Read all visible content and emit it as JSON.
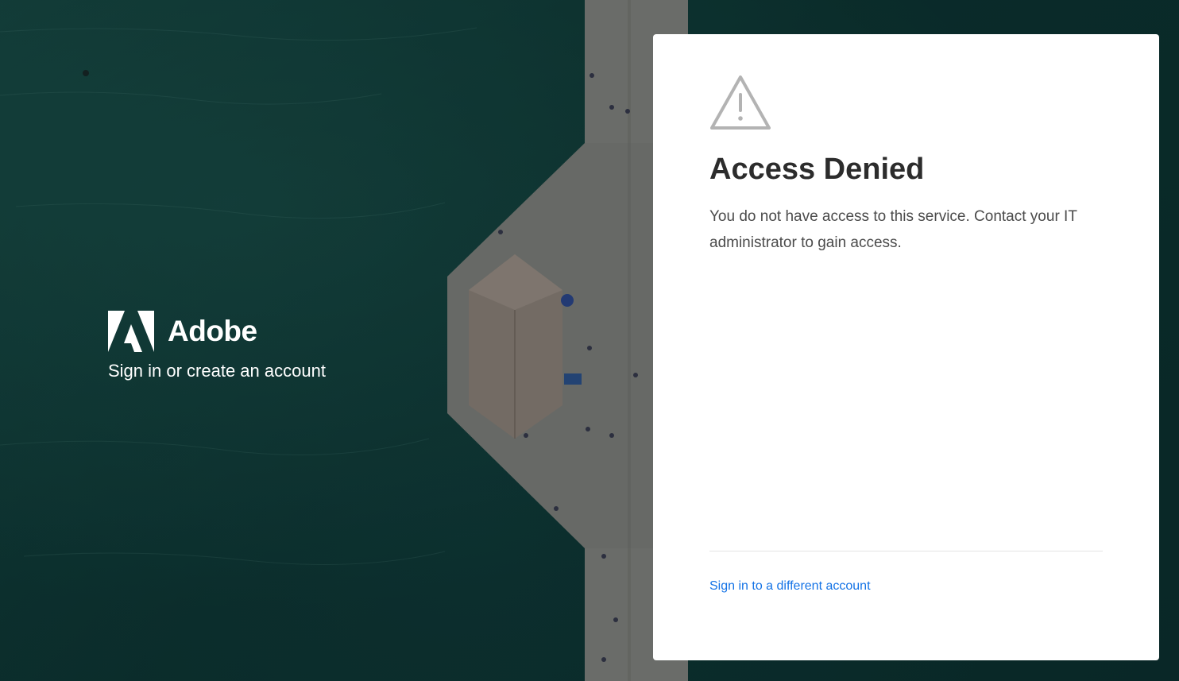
{
  "brand": {
    "name": "Adobe",
    "tagline": "Sign in or create an account"
  },
  "card": {
    "icon": "warning-icon",
    "title": "Access Denied",
    "message": "You do not have access to this service. Contact your IT administrator to gain access.",
    "alt_link_label": "Sign in to a different account"
  },
  "colors": {
    "link": "#1473e6",
    "title": "#2c2c2c",
    "message": "#4b4b4b",
    "background_water": "#0f3b39",
    "card": "#ffffff"
  }
}
